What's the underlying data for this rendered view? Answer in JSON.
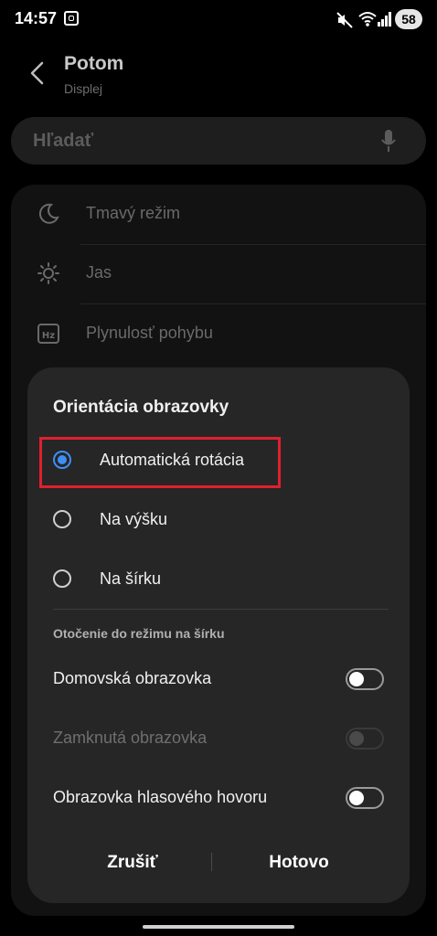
{
  "status_bar": {
    "time": "14:57",
    "battery": "58"
  },
  "header": {
    "title": "Potom",
    "subtitle": "Displej"
  },
  "search": {
    "placeholder": "Hľadať"
  },
  "settings_list": {
    "items": [
      {
        "label": "Tmavý režim",
        "icon": "moon-icon"
      },
      {
        "label": "Jas",
        "icon": "sun-icon"
      },
      {
        "label": "Plynulosť pohybu",
        "icon": "hz-icon"
      }
    ]
  },
  "dialog": {
    "title": "Orientácia obrazovky",
    "options": [
      {
        "label": "Automatická rotácia",
        "selected": true
      },
      {
        "label": "Na výšku",
        "selected": false
      },
      {
        "label": "Na šírku",
        "selected": false
      }
    ],
    "section_title": "Otočenie do režimu na šírku",
    "toggles": [
      {
        "label": "Domovská obrazovka",
        "on": false,
        "enabled": true
      },
      {
        "label": "Zamknutá obrazovka",
        "on": false,
        "enabled": false
      },
      {
        "label": "Obrazovka hlasového hovoru",
        "on": false,
        "enabled": true
      }
    ],
    "cancel_label": "Zrušiť",
    "done_label": "Hotovo"
  },
  "colors": {
    "accent": "#3f8ef5",
    "highlight_box": "#e0202e",
    "dialog_bg": "#262626"
  }
}
